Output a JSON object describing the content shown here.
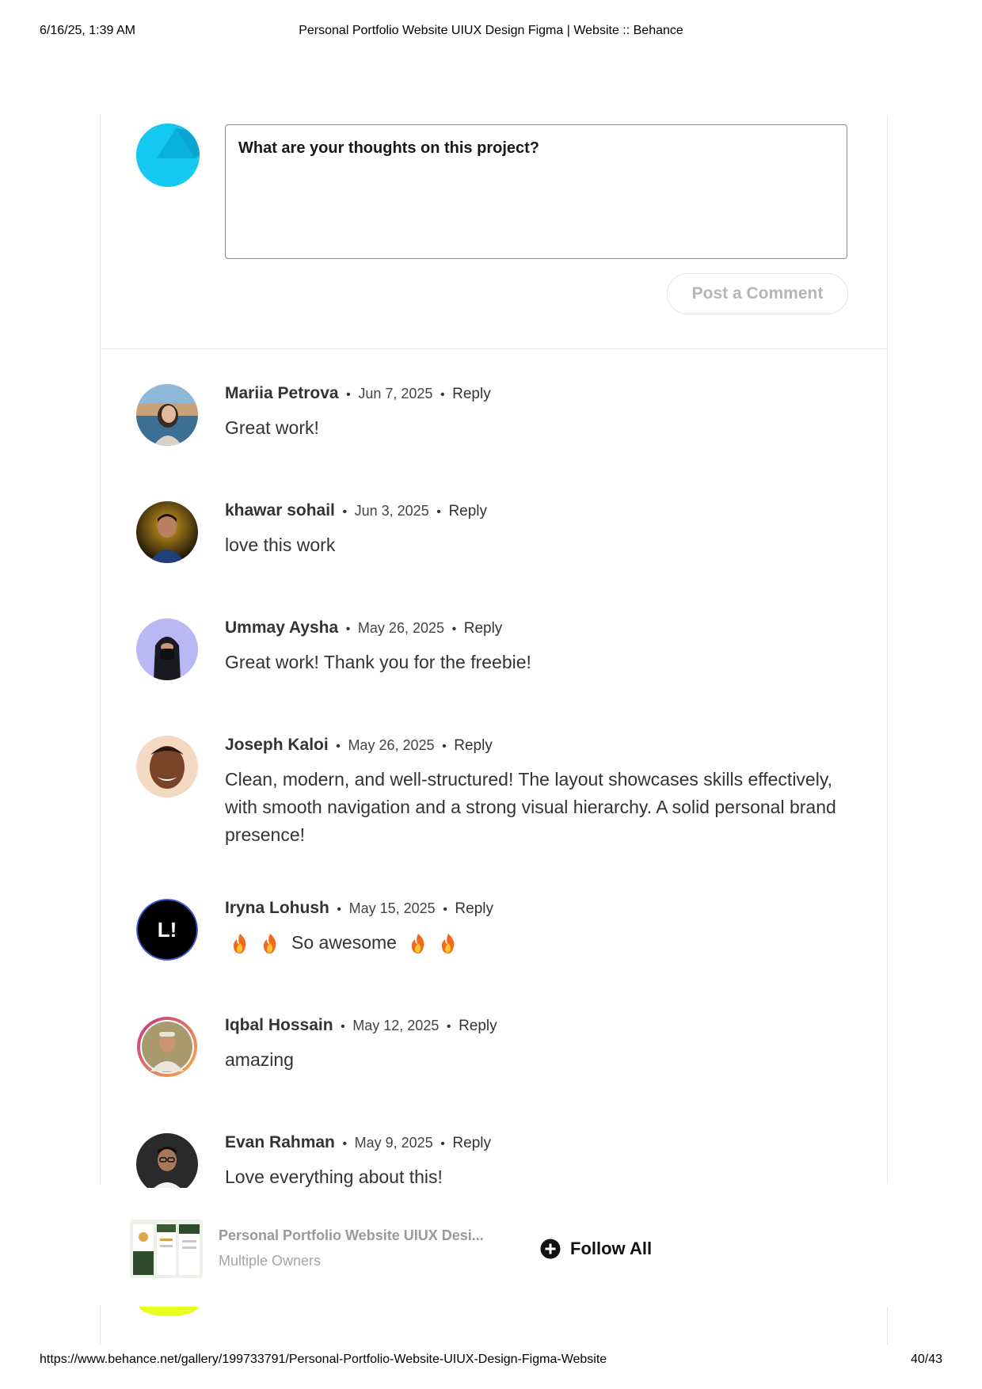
{
  "print_header": {
    "datetime": "6/16/25, 1:39 AM",
    "title": "Personal Portfolio Website UIUX Design Figma | Website :: Behance"
  },
  "print_footer": {
    "url": "https://www.behance.net/gallery/199733791/Personal-Portfolio-Website-UIUX-Design-Figma-Website",
    "page": "40/43"
  },
  "comment_form": {
    "placeholder": "What are your thoughts on this project?",
    "post_label": "Post a Comment"
  },
  "separator": "•",
  "comments": [
    {
      "name": "Mariia Petrova",
      "date": "Jun 7, 2025",
      "reply": "Reply",
      "text": "Great work!"
    },
    {
      "name": "khawar sohail",
      "date": "Jun 3, 2025",
      "reply": "Reply",
      "text": "love this work"
    },
    {
      "name": "Ummay Aysha",
      "date": "May 26, 2025",
      "reply": "Reply",
      "text": "Great work! Thank you for the freebie!"
    },
    {
      "name": "Joseph Kaloi",
      "date": "May 26, 2025",
      "reply": "Reply",
      "text": "Clean, modern, and well-structured! The layout showcases skills effectively, with smooth navigation and a strong visual hierarchy. A solid personal brand presence!"
    },
    {
      "name": "Iryna Lohush",
      "date": "May 15, 2025",
      "reply": "Reply",
      "text": "So awesome"
    },
    {
      "name": "Iqbal Hossain",
      "date": "May 12, 2025",
      "reply": "Reply",
      "text": "amazing"
    },
    {
      "name": "Evan Rahman",
      "date": "May 9, 2025",
      "reply": "Reply",
      "text": "Love everything about this!"
    }
  ],
  "iryna_logo_text": "L!",
  "bottom_bar": {
    "project_title": "Personal Portfolio Website UIUX Desi...",
    "owners": "Multiple Owners",
    "follow_label": "Follow All"
  },
  "icons": {
    "plus": "plus-circle-icon",
    "fire": "fire-emoji-icon"
  },
  "colors": {
    "accent_avatar": "#14c8ef",
    "follow_icon": "#111111",
    "peek_avatar": "#e6ff1f"
  }
}
